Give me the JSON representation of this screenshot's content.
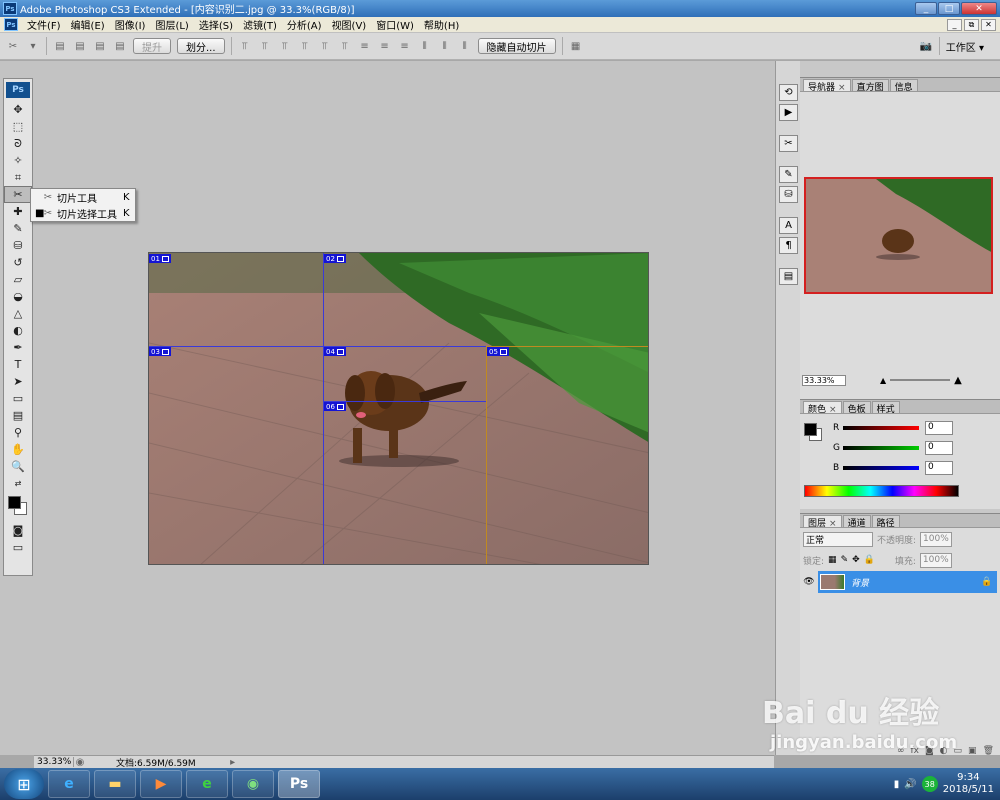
{
  "window": {
    "title": "Adobe Photoshop CS3 Extended - [内容识别二.jpg @ 33.3%(RGB/8)]",
    "app_icon": "Ps",
    "controls": [
      "_",
      "□",
      "✕"
    ]
  },
  "menubar": {
    "items": [
      "文件(F)",
      "编辑(E)",
      "图像(I)",
      "图层(L)",
      "选择(S)",
      "滤镜(T)",
      "分析(A)",
      "视图(V)",
      "窗口(W)",
      "帮助(H)"
    ],
    "mdi_controls": [
      "_",
      "⧉",
      "✕"
    ]
  },
  "optionsbar": {
    "promote_label": "提升",
    "divide_label": "划分...",
    "hide_auto_slices_label": "隐藏自动切片",
    "workspace_label": "工作区 ▾"
  },
  "toolbox": {
    "logo": "Ps"
  },
  "flyout": {
    "items": [
      {
        "label": "切片工具",
        "key": "K",
        "selected": false
      },
      {
        "label": "切片选择工具",
        "key": "K",
        "selected": true
      }
    ]
  },
  "canvas": {
    "slices": [
      "01",
      "02",
      "03",
      "04",
      "05",
      "06"
    ],
    "slice_colors": {
      "user": "#1414d4",
      "auto": "#c08a20"
    }
  },
  "statusbar": {
    "zoom": "33.33%",
    "doc": "文档:6.59M/6.59M"
  },
  "navigator": {
    "tabs": [
      "导航器",
      "直方图",
      "信息"
    ],
    "zoom": "33.33%"
  },
  "color_panel": {
    "tabs": [
      "颜色",
      "色板",
      "样式"
    ],
    "channels": [
      {
        "label": "R",
        "value": "0",
        "color": "#d02020"
      },
      {
        "label": "G",
        "value": "0",
        "color": "#20a020"
      },
      {
        "label": "B",
        "value": "0",
        "color": "#2020d0"
      }
    ]
  },
  "layers_panel": {
    "tabs": [
      "图层",
      "通道",
      "路径"
    ],
    "blend_mode": "正常",
    "opacity_label": "不透明度:",
    "opacity_value": "100%",
    "lock_label": "锁定:",
    "fill_label": "填充:",
    "fill_value": "100%",
    "layer_name": "背景"
  },
  "taskbar": {
    "apps": [
      "windows-start",
      "ie-browser",
      "file-explorer",
      "media-player",
      "360-browser",
      "wechat",
      "photoshop"
    ],
    "ps_label": "Ps",
    "tray_badge": "38",
    "time": "9:34",
    "date": "2018/5/11"
  },
  "watermark": {
    "brand": "Bai du 经验",
    "url": "jingyan.baidu.com"
  }
}
